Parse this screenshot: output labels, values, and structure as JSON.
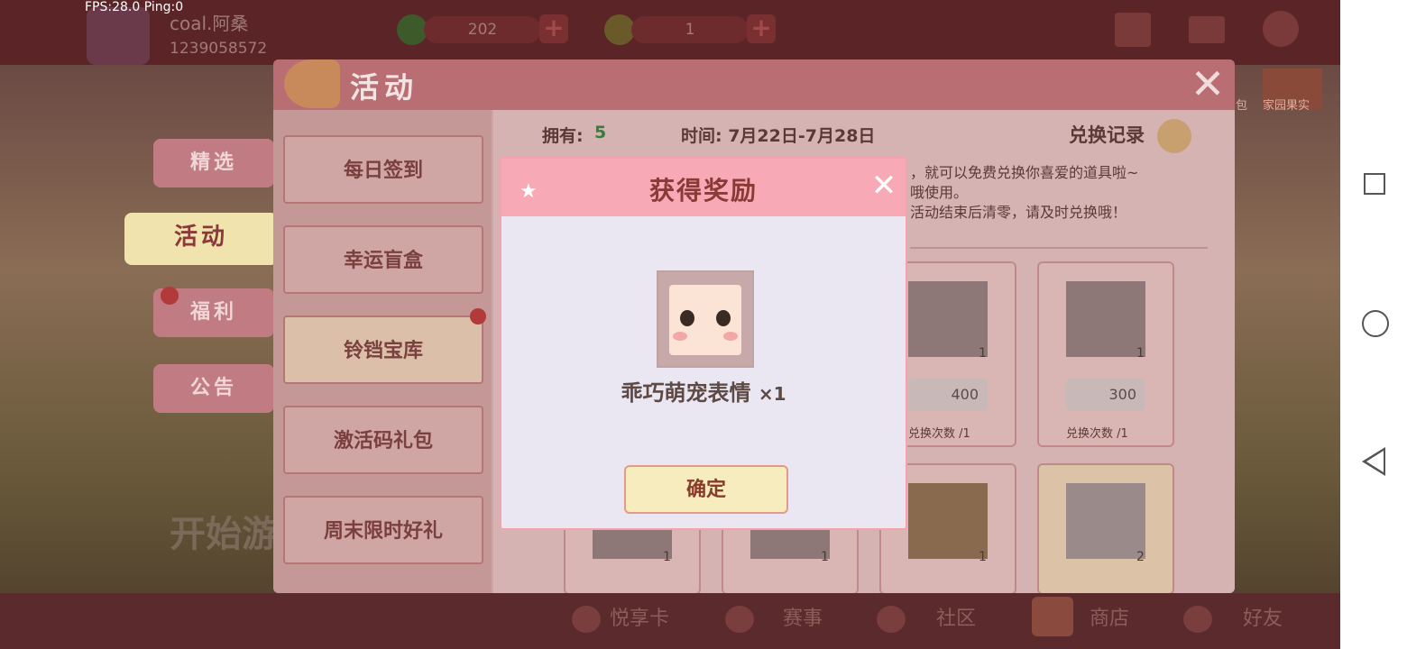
{
  "debug": {
    "text": "FPS:28.0  Ping:0"
  },
  "player": {
    "name": "coal.阿桑",
    "id": "1239058572"
  },
  "currency": {
    "gems": "202",
    "coins": "1"
  },
  "side_tabs": [
    "精选",
    "活动",
    "福利",
    "公告"
  ],
  "start_text": "开始游",
  "panel": {
    "title": "活动",
    "menu": [
      "每日签到",
      "幸运盲盒",
      "铃铛宝库",
      "激活码礼包",
      "周末限时好礼"
    ],
    "owned_label": "拥有:",
    "owned_value": "5",
    "time_text": "时间: 7月22日-7月28日",
    "exchange_record": "兑换记录",
    "desc_line1": "，就可以免费兑换你喜爱的道具啦~",
    "desc_line2": "哦使用。",
    "desc_line3": "活动结束后清零，请及时兑换哦！",
    "cards": [
      {
        "count": "1",
        "price": "400",
        "limit": "兑换次数 /1"
      },
      {
        "count": "1",
        "price": "300",
        "limit": "兑换次数 /1"
      }
    ],
    "bottom_counts": [
      "1",
      "1",
      "1",
      "2"
    ]
  },
  "top_right": {
    "home_fruit": "家园果实",
    "pack": "包"
  },
  "bottom_nav": [
    "悦享卡",
    "赛事",
    "社区",
    "商店",
    "好友"
  ],
  "dialog": {
    "title": "获得奖励",
    "item_name": "乖巧萌宠表情",
    "item_qty": "×1",
    "ok": "确定"
  }
}
